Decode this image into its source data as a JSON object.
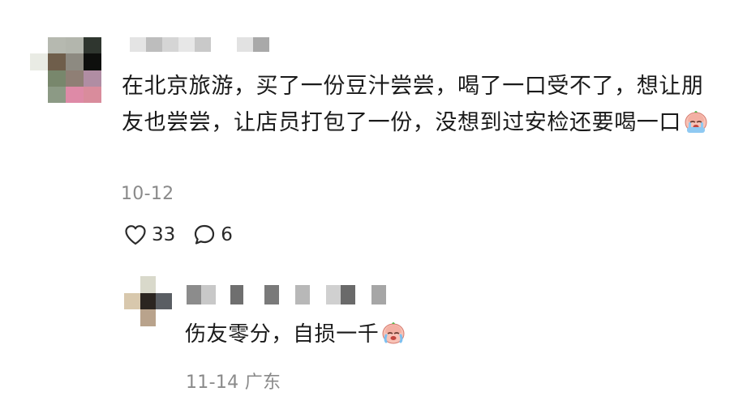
{
  "comment": {
    "text": "在北京旅游，买了一份豆汁尝尝，喝了一口受不了，想让朋友也尝尝，让店员打包了一份，没想到过安检还要喝一口",
    "emoji": "crying-face-emoji",
    "date": "10-12",
    "likes": "33",
    "replies": "6"
  },
  "reply": {
    "text": "伤友零分，自损一千",
    "emoji": "crying-face-emoji",
    "date_location": "11-14 广东"
  },
  "colors": {
    "text": "#1a1a1a",
    "meta": "#8a8a8a",
    "icon": "#2a2a2a"
  }
}
